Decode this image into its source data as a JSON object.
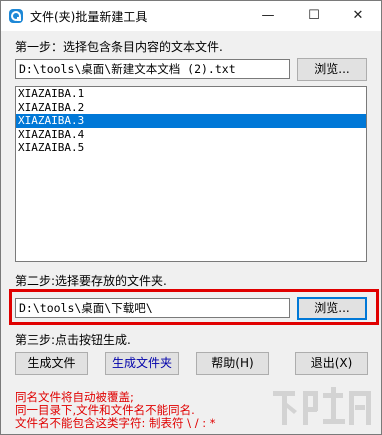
{
  "window": {
    "title": "文件(夹)批量新建工具",
    "min_glyph": "—",
    "max_glyph": "☐",
    "close_glyph": "✕"
  },
  "step1": {
    "label": "第一步：选择包含条目内容的文本文件.",
    "path": "D:\\tools\\桌面\\新建文本文档 (2).txt",
    "browse": "浏览..."
  },
  "list": {
    "items": [
      "XIAZAIBA.1",
      "XIAZAIBA.2",
      "XIAZAIBA.3",
      "XIAZAIBA.4",
      "XIAZAIBA.5"
    ],
    "selected_index": 2
  },
  "step2": {
    "label": "第二步:选择要存放的文件夹.",
    "path": "D:\\tools\\桌面\\下载吧\\",
    "browse": "浏览..."
  },
  "step3": {
    "label": "第三步:点击按钮生成."
  },
  "buttons": {
    "gen_file": "生成文件",
    "gen_folder": "生成文件夹",
    "help": "帮助(H)",
    "exit": "退出(X)"
  },
  "warnings": [
    "同名文件将自动被覆盖;",
    "同一目录下,文件和文件名不能同名.",
    "文件名不能包含这类字符: 制表符 \\ / : *"
  ],
  "colors": {
    "accent": "#0078d7",
    "highlight_box": "#e00000",
    "warning_text": "#e00000"
  }
}
